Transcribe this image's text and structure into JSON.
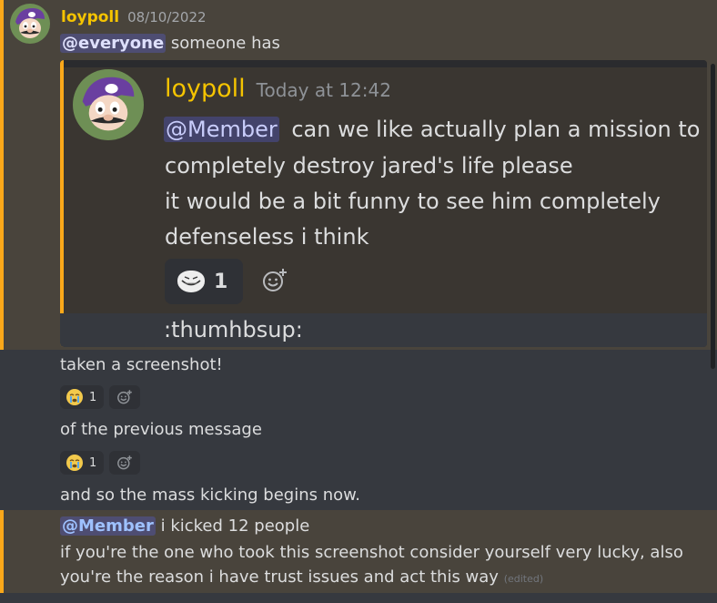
{
  "message1": {
    "author": "loypoll",
    "timestamp": "08/10/2022",
    "mention": "@everyone",
    "text": "someone has",
    "embed": {
      "author": "loypoll",
      "timestamp": "Today at 12:42",
      "mention": "@Member",
      "line1": "can we like actually plan a mission to",
      "line2": "completely destroy jared's life please",
      "line3": "it would be a bit funny to see him completely",
      "line4": "defenseless i think",
      "reaction_count": "1",
      "followup": ":thumhbsup:"
    }
  },
  "message2": {
    "text": "taken a screenshot!",
    "reaction_count": "1"
  },
  "message3": {
    "text": "of the previous message",
    "reaction_count": "1"
  },
  "message4": {
    "text": "and so the mass kicking begins now."
  },
  "message5": {
    "mention": "@Member",
    "text1": "i kicked 12 people",
    "text2": "if you're the one who took this screenshot consider yourself very lucky, also",
    "text3": "you're the reason i have trust issues and act this way",
    "edited": "(edited)"
  },
  "colors": {
    "background": "#36393f",
    "highlight": "#49443c",
    "highlight_bar": "#faa81a",
    "username": "#f5c400",
    "mention": "#5865f2"
  }
}
